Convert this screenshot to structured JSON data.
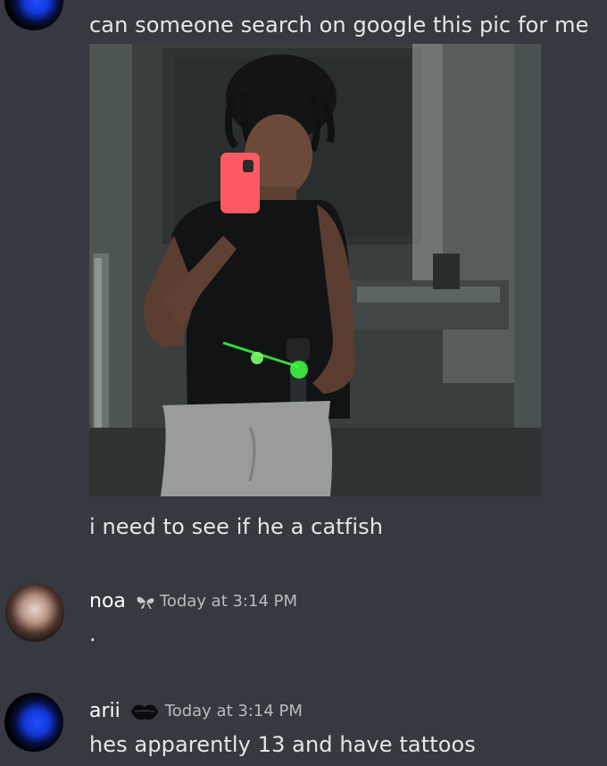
{
  "messages": [
    {
      "avatar": "blue-avatar",
      "text": "can someone search on google this pic for me",
      "attachment": "mirror-selfie-photo",
      "followup": "i need to see if he a catfish"
    },
    {
      "username": "noa",
      "badge_icon": "butterfly-icon",
      "timestamp": "Today at 3:14 PM",
      "text": "."
    },
    {
      "username": "arii",
      "badge_icon": "lips-icon",
      "timestamp": "Today at 3:14 PM",
      "text": "hes apparently 13 and have tattoos"
    }
  ],
  "colors": {
    "background": "#36393f",
    "text": "#e6e6e6",
    "timestamp": "#b9bbbe",
    "avatar_blue": "#1e4fff",
    "laser_green": "#3cff3c",
    "phone_pink": "#ff5a64"
  }
}
